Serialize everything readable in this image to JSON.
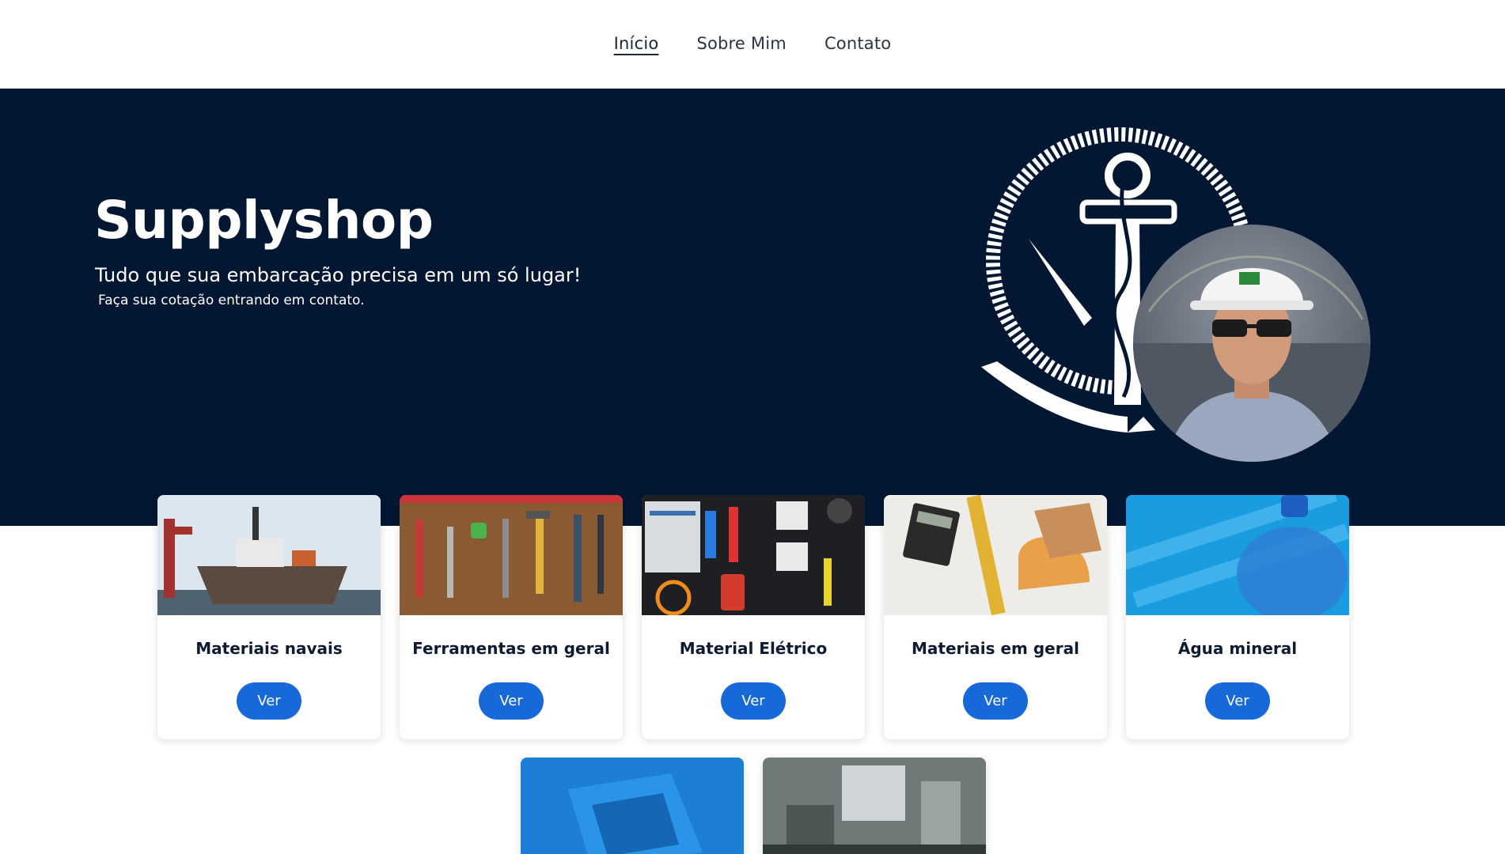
{
  "nav": {
    "items": [
      {
        "label": "Início",
        "active": true
      },
      {
        "label": "Sobre Mim",
        "active": false
      },
      {
        "label": "Contato",
        "active": false
      }
    ]
  },
  "hero": {
    "title": "Supplyshop",
    "subtitle": "Tudo que sua embarcação precisa em um só lugar!",
    "note": "Faça sua cotação entrando em contato.",
    "background": "#031733"
  },
  "cards": [
    {
      "title": "Materiais navais",
      "button": "Ver"
    },
    {
      "title": "Ferramentas em geral",
      "button": "Ver"
    },
    {
      "title": "Material Elétrico",
      "button": "Ver"
    },
    {
      "title": "Materiais em geral",
      "button": "Ver"
    },
    {
      "title": "Água mineral",
      "button": "Ver"
    }
  ],
  "colors": {
    "accent_button": "#1769d9",
    "hero_bg": "#031733"
  }
}
